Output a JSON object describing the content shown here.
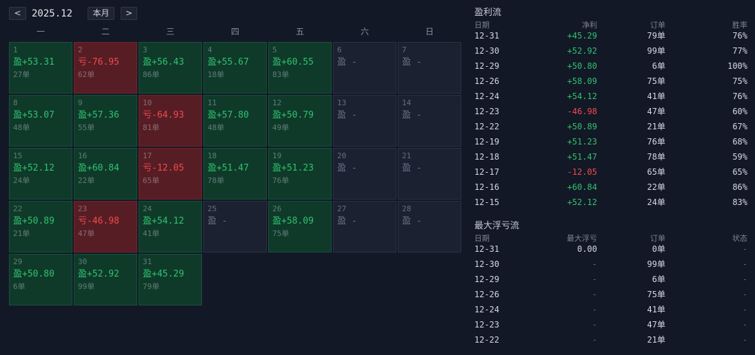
{
  "colors": {
    "background": "#131826",
    "profit": "#2fc26f",
    "loss": "#f04b4b",
    "profit_cell": "#0f3a2a",
    "loss_cell": "#571d24",
    "empty_cell": "#1b2130"
  },
  "toolbar": {
    "prev_label": "<",
    "month_label": "2025.12",
    "current_month_label": "本月",
    "next_label": ">"
  },
  "weekdays": [
    "一",
    "二",
    "三",
    "四",
    "五",
    "六",
    "日"
  ],
  "calendar_cells": [
    {
      "day": "1",
      "status": "profit",
      "text": "盈+53.31",
      "orders": "27单"
    },
    {
      "day": "2",
      "status": "loss",
      "text": "亏-76.95",
      "orders": "62单"
    },
    {
      "day": "3",
      "status": "profit",
      "text": "盈+56.43",
      "orders": "86单"
    },
    {
      "day": "4",
      "status": "profit",
      "text": "盈+55.67",
      "orders": "18单"
    },
    {
      "day": "5",
      "status": "profit",
      "text": "盈+60.55",
      "orders": "83单"
    },
    {
      "day": "6",
      "status": "empty",
      "text": "盈 -"
    },
    {
      "day": "7",
      "status": "empty",
      "text": "盈 -"
    },
    {
      "day": "8",
      "status": "profit",
      "text": "盈+53.07",
      "orders": "48单"
    },
    {
      "day": "9",
      "status": "profit",
      "text": "盈+57.36",
      "orders": "55单"
    },
    {
      "day": "10",
      "status": "loss",
      "text": "亏-64.93",
      "orders": "81单"
    },
    {
      "day": "11",
      "status": "profit",
      "text": "盈+57.80",
      "orders": "48单"
    },
    {
      "day": "12",
      "status": "profit",
      "text": "盈+50.79",
      "orders": "49单"
    },
    {
      "day": "13",
      "status": "empty",
      "text": "盈 -"
    },
    {
      "day": "14",
      "status": "empty",
      "text": "盈 -"
    },
    {
      "day": "15",
      "status": "profit",
      "text": "盈+52.12",
      "orders": "24单"
    },
    {
      "day": "16",
      "status": "profit",
      "text": "盈+60.84",
      "orders": "22单"
    },
    {
      "day": "17",
      "status": "loss",
      "text": "亏-12.05",
      "orders": "65单"
    },
    {
      "day": "18",
      "status": "profit",
      "text": "盈+51.47",
      "orders": "78单"
    },
    {
      "day": "19",
      "status": "profit",
      "text": "盈+51.23",
      "orders": "76单"
    },
    {
      "day": "20",
      "status": "empty",
      "text": "盈 -"
    },
    {
      "day": "21",
      "status": "empty",
      "text": "盈 -"
    },
    {
      "day": "22",
      "status": "profit",
      "text": "盈+50.89",
      "orders": "21单"
    },
    {
      "day": "23",
      "status": "loss",
      "text": "亏-46.98",
      "orders": "47单"
    },
    {
      "day": "24",
      "status": "profit",
      "text": "盈+54.12",
      "orders": "41单"
    },
    {
      "day": "25",
      "status": "empty",
      "text": "盈 -"
    },
    {
      "day": "26",
      "status": "profit",
      "text": "盈+58.09",
      "orders": "75单"
    },
    {
      "day": "27",
      "status": "empty",
      "text": "盈 -"
    },
    {
      "day": "28",
      "status": "empty",
      "text": "盈 -"
    },
    {
      "day": "29",
      "status": "profit",
      "text": "盈+50.80",
      "orders": "6单"
    },
    {
      "day": "30",
      "status": "profit",
      "text": "盈+52.92",
      "orders": "99单"
    },
    {
      "day": "31",
      "status": "profit",
      "text": "盈+45.29",
      "orders": "79单"
    }
  ],
  "profit_flow": {
    "title": "盈利流",
    "headers": {
      "date": "日期",
      "pnl": "净利",
      "orders": "订单",
      "win_rate": "胜率"
    },
    "rows": [
      {
        "date": "12-31",
        "pnl": "+45.29",
        "orders": "79单",
        "win_rate": "76%"
      },
      {
        "date": "12-30",
        "pnl": "+52.92",
        "orders": "99单",
        "win_rate": "77%"
      },
      {
        "date": "12-29",
        "pnl": "+50.80",
        "orders": "6单",
        "win_rate": "100%"
      },
      {
        "date": "12-26",
        "pnl": "+58.09",
        "orders": "75单",
        "win_rate": "75%"
      },
      {
        "date": "12-24",
        "pnl": "+54.12",
        "orders": "41单",
        "win_rate": "76%"
      },
      {
        "date": "12-23",
        "pnl": "-46.98",
        "orders": "47单",
        "win_rate": "60%"
      },
      {
        "date": "12-22",
        "pnl": "+50.89",
        "orders": "21单",
        "win_rate": "67%"
      },
      {
        "date": "12-19",
        "pnl": "+51.23",
        "orders": "76单",
        "win_rate": "68%"
      },
      {
        "date": "12-18",
        "pnl": "+51.47",
        "orders": "78单",
        "win_rate": "59%"
      },
      {
        "date": "12-17",
        "pnl": "-12.05",
        "orders": "65单",
        "win_rate": "65%"
      },
      {
        "date": "12-16",
        "pnl": "+60.84",
        "orders": "22单",
        "win_rate": "86%"
      },
      {
        "date": "12-15",
        "pnl": "+52.12",
        "orders": "24单",
        "win_rate": "83%"
      }
    ]
  },
  "drawdown_flow": {
    "title": "最大浮亏流",
    "headers": {
      "date": "日期",
      "max_drawdown": "最大浮亏",
      "orders": "订单",
      "status": "状态"
    },
    "rows": [
      {
        "date": "12-31",
        "max_drawdown": "0.00",
        "orders": "0单",
        "status": "-"
      },
      {
        "date": "12-30",
        "max_drawdown": "-",
        "orders": "99单",
        "status": "-"
      },
      {
        "date": "12-29",
        "max_drawdown": "-",
        "orders": "6单",
        "status": "-"
      },
      {
        "date": "12-26",
        "max_drawdown": "-",
        "orders": "75单",
        "status": "-"
      },
      {
        "date": "12-24",
        "max_drawdown": "-",
        "orders": "41单",
        "status": "-"
      },
      {
        "date": "12-23",
        "max_drawdown": "-",
        "orders": "47单",
        "status": "-"
      },
      {
        "date": "12-22",
        "max_drawdown": "-",
        "orders": "21单",
        "status": "-"
      }
    ]
  }
}
